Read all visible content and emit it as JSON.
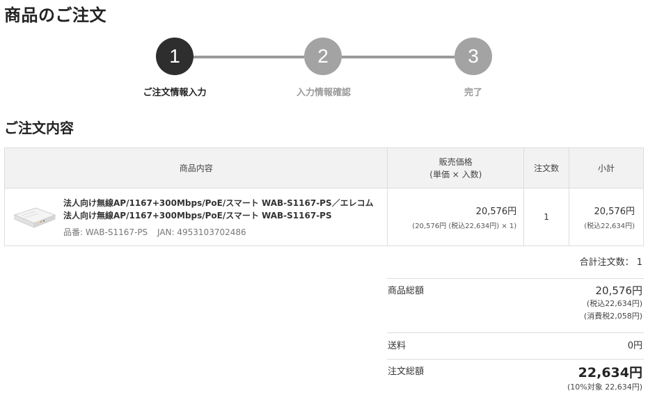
{
  "page": {
    "title": "商品のご注文"
  },
  "steps": [
    {
      "number": "1",
      "label": "ご注文情報入力",
      "state": "active"
    },
    {
      "number": "2",
      "label": "入力情報確認",
      "state": "inactive"
    },
    {
      "number": "3",
      "label": "完了",
      "state": "inactive"
    }
  ],
  "section": {
    "title": "ご注文内容"
  },
  "table": {
    "headers": {
      "item": "商品内容",
      "price_line1": "販売価格",
      "price_line2": "(単価 × 入数)",
      "qty": "注文数",
      "subtotal": "小計"
    },
    "rows": [
      {
        "name": "法人向け無線AP/1167+300Mbps/PoE/スマート WAB-S1167-PS／エレコム 法人向け無線AP/1167+300Mbps/PoE/スマート WAB-S1167-PS",
        "part_number": "品番: WAB-S1167-PS",
        "jan": "JAN: 4953103702486",
        "price": "20,576円",
        "price_detail": "(20,576円 (税込22,634円) × 1)",
        "qty": "1",
        "subtotal": "20,576円",
        "subtotal_tax": "(税込22,634円)"
      }
    ]
  },
  "summary": {
    "count_line": "合計注文数： 1",
    "goods_label": "商品総額",
    "goods_value": "20,576円",
    "goods_tax_incl": "(税込22,634円)",
    "goods_tax": "(消費税2,058円)",
    "shipping_label": "送料",
    "shipping_value": "0円",
    "total_label": "注文総額",
    "total_value": "22,634円",
    "total_note": "(10%対象 22,634円)"
  },
  "colors": {
    "active_step": "#2e2e2e",
    "inactive_step": "#a3a3a3",
    "header_bg": "#f2f2f2"
  }
}
